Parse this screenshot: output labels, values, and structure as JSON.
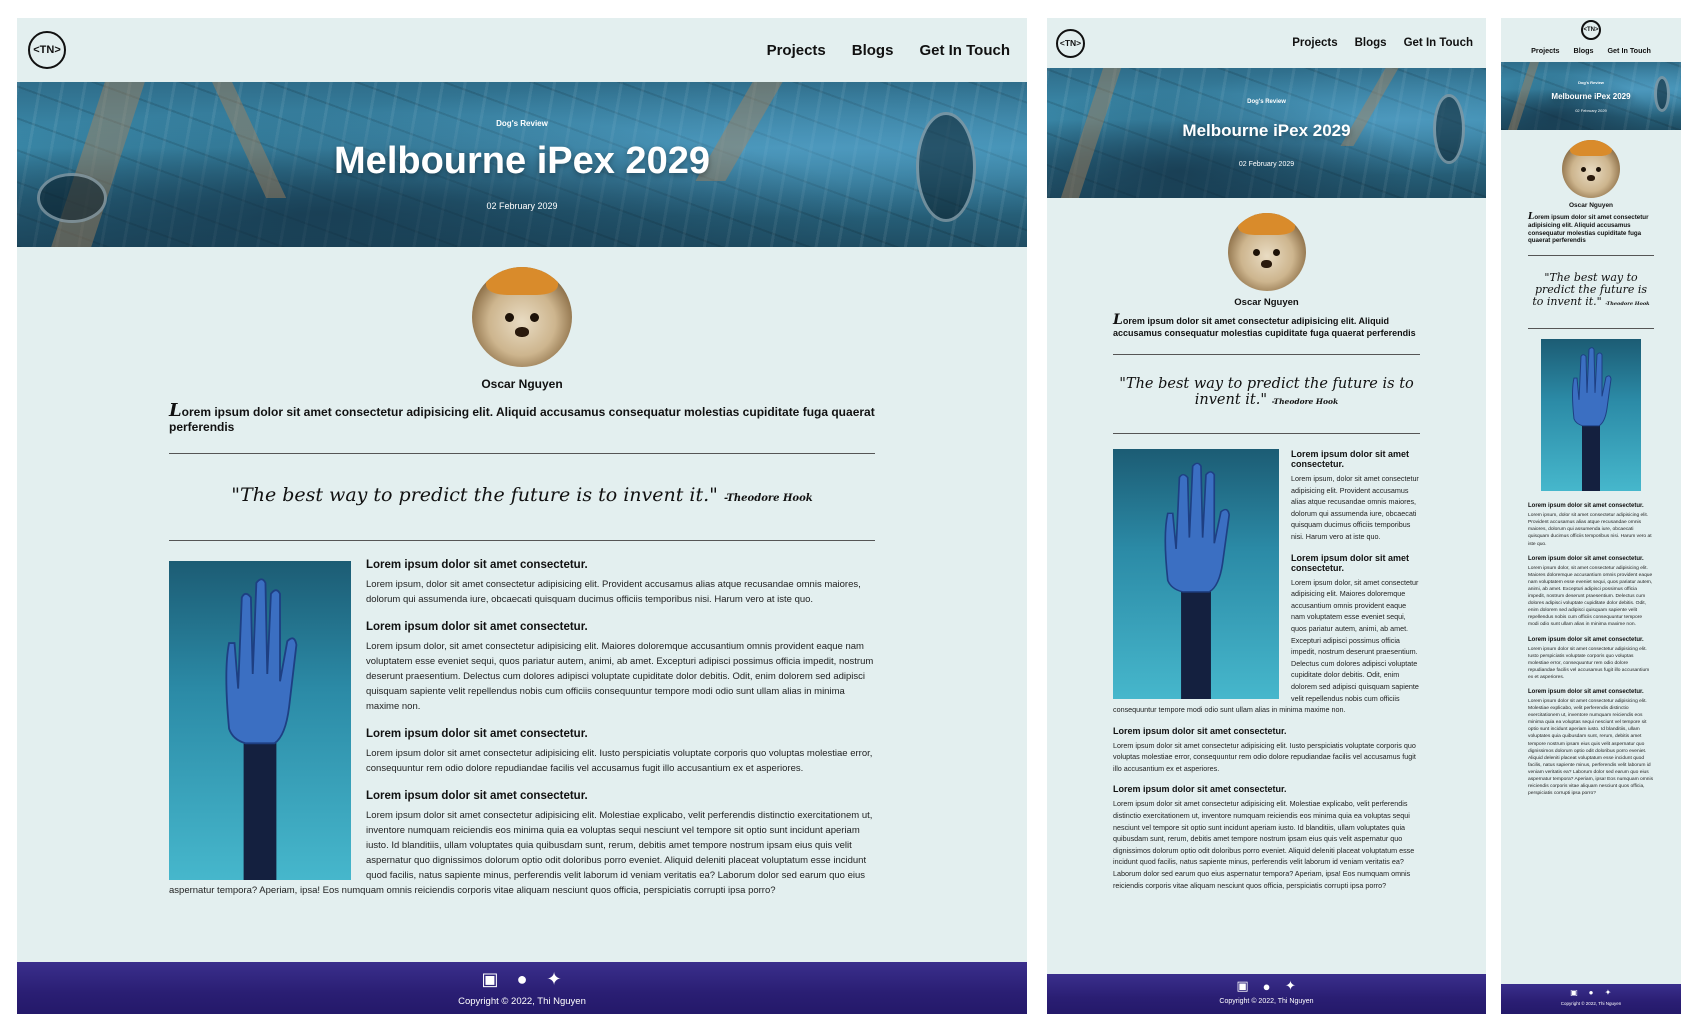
{
  "site": {
    "logo_text": "<TN>",
    "nav": [
      "Projects",
      "Blogs",
      "Get In Touch"
    ]
  },
  "hero": {
    "category": "Dog's Review",
    "title": "Melbourne iPex 2029",
    "date": "02 February 2029"
  },
  "author": {
    "name": "Oscar Nguyen"
  },
  "lead": {
    "dropcap": "L",
    "text": "orem ipsum dolor sit amet consectetur adipisicing elit. Aliquid accusamus consequatur molestias cupiditate fuga quaerat perferendis"
  },
  "quote": {
    "text": "\"The best way to predict the future is to invent it.\"",
    "attribution": "-Theodore Hook"
  },
  "sections": [
    {
      "heading": "Lorem ipsum dolor sit amet consectetur.",
      "body": "Lorem ipsum, dolor sit amet consectetur adipisicing elit. Provident accusamus alias atque recusandae omnis maiores, dolorum qui assumenda iure, obcaecati quisquam ducimus officiis temporibus nisi. Harum vero at iste quo."
    },
    {
      "heading": "Lorem ipsum dolor sit amet consectetur.",
      "body": "Lorem ipsum dolor, sit amet consectetur adipisicing elit. Maiores doloremque accusantium omnis provident eaque nam voluptatem esse eveniet sequi, quos pariatur autem, animi, ab amet. Excepturi adipisci possimus officia impedit, nostrum deserunt praesentium. Delectus cum dolores adipisci voluptate cupiditate dolor debitis. Odit, enim dolorem sed adipisci quisquam sapiente velit repellendus nobis cum officiis consequuntur tempore modi odio sunt ullam alias in minima maxime non."
    },
    {
      "heading": "Lorem ipsum dolor sit amet consectetur.",
      "body": "Lorem ipsum dolor sit amet consectetur adipisicing elit. Iusto perspiciatis voluptate corporis quo voluptas molestiae error, consequuntur rem odio dolore repudiandae facilis vel accusamus fugit illo accusantium ex et asperiores."
    },
    {
      "heading": "Lorem ipsum dolor sit amet consectetur.",
      "body": "Lorem ipsum dolor sit amet consectetur adipisicing elit. Molestiae explicabo, velit perferendis distinctio exercitationem ut, inventore numquam reiciendis eos minima quia ea voluptas sequi nesciunt vel tempore sit optio sunt incidunt aperiam iusto. Id blanditiis, ullam voluptates quia quibusdam sunt, rerum, debitis amet tempore nostrum ipsam eius quis velit aspernatur quo dignissimos dolorum optio odit doloribus porro eveniet. Aliquid deleniti placeat voluptatum esse incidunt quod facilis, natus sapiente minus, perferendis velit laborum id veniam veritatis ea? Laborum dolor sed earum quo eius aspernatur tempora? Aperiam, ipsa! Eos numquam omnis reiciendis corporis vitae aliquam nesciunt quos officia, perspiciatis corrupti ipsa porro?"
    }
  ],
  "footer": {
    "icons": [
      "linkedin-icon",
      "github-icon",
      "twitter-icon"
    ],
    "copyright": "Copyright © 2022, Thi Nguyen"
  },
  "colors": {
    "page_bg": "#e3efef",
    "footer_bg": "#2a1e73",
    "hero_tint": "#3d8fb0",
    "hand_bg": "#46b7cc"
  }
}
